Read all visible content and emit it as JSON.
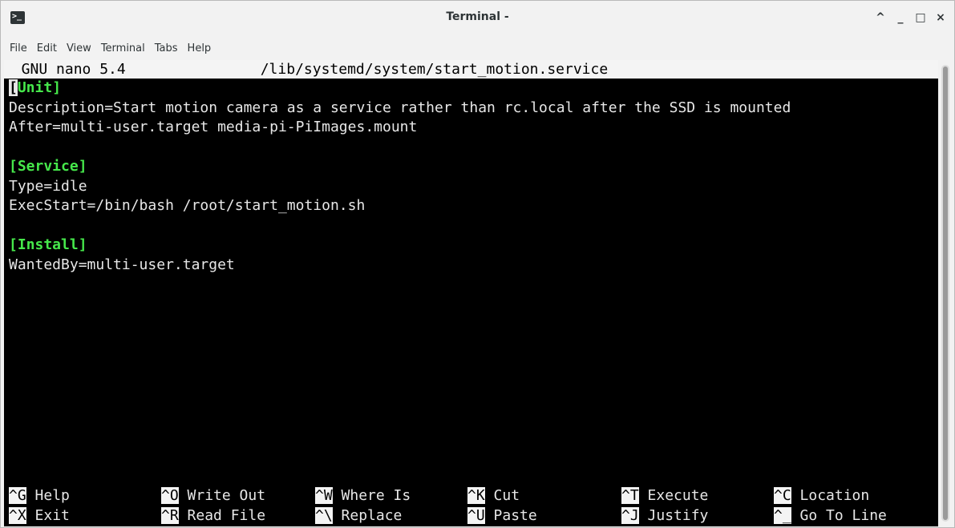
{
  "window": {
    "title": "Terminal -",
    "app_icon": "terminal-icon",
    "controls": [
      {
        "name": "shade-button",
        "glyph": "^"
      },
      {
        "name": "minimize-button",
        "glyph": "_"
      },
      {
        "name": "maximize-button",
        "glyph": "□"
      },
      {
        "name": "close-button",
        "glyph": "×"
      }
    ]
  },
  "menu": [
    "File",
    "Edit",
    "View",
    "Terminal",
    "Tabs",
    "Help"
  ],
  "nano": {
    "version": "  GNU nano 5.4",
    "filename": "/lib/systemd/system/start_motion.service",
    "lines": [
      {
        "text": "[Unit]",
        "section": true
      },
      {
        "text": "Description=Start motion camera as a service rather than rc.local after the SSD is mounted",
        "section": false
      },
      {
        "text": "After=multi-user.target media-pi-PiImages.mount",
        "section": false
      },
      {
        "text": "",
        "section": false
      },
      {
        "text": "[Service]",
        "section": true
      },
      {
        "text": "Type=idle",
        "section": false
      },
      {
        "text": "ExecStart=/bin/bash /root/start_motion.sh",
        "section": false
      },
      {
        "text": "",
        "section": false
      },
      {
        "text": "[Install]",
        "section": true
      },
      {
        "text": "WantedBy=multi-user.target",
        "section": false
      }
    ],
    "shortcuts": [
      [
        {
          "key": "^G",
          "label": " Help"
        },
        {
          "key": "^O",
          "label": " Write Out"
        },
        {
          "key": "^W",
          "label": " Where Is"
        },
        {
          "key": "^K",
          "label": " Cut"
        },
        {
          "key": "^T",
          "label": " Execute"
        },
        {
          "key": "^C",
          "label": " Location"
        }
      ],
      [
        {
          "key": "^X",
          "label": " Exit"
        },
        {
          "key": "^R",
          "label": " Read File"
        },
        {
          "key": "^\\",
          "label": " Replace"
        },
        {
          "key": "^U",
          "label": " Paste"
        },
        {
          "key": "^J",
          "label": " Justify"
        },
        {
          "key": "^_",
          "label": " Go To Line"
        }
      ]
    ]
  }
}
